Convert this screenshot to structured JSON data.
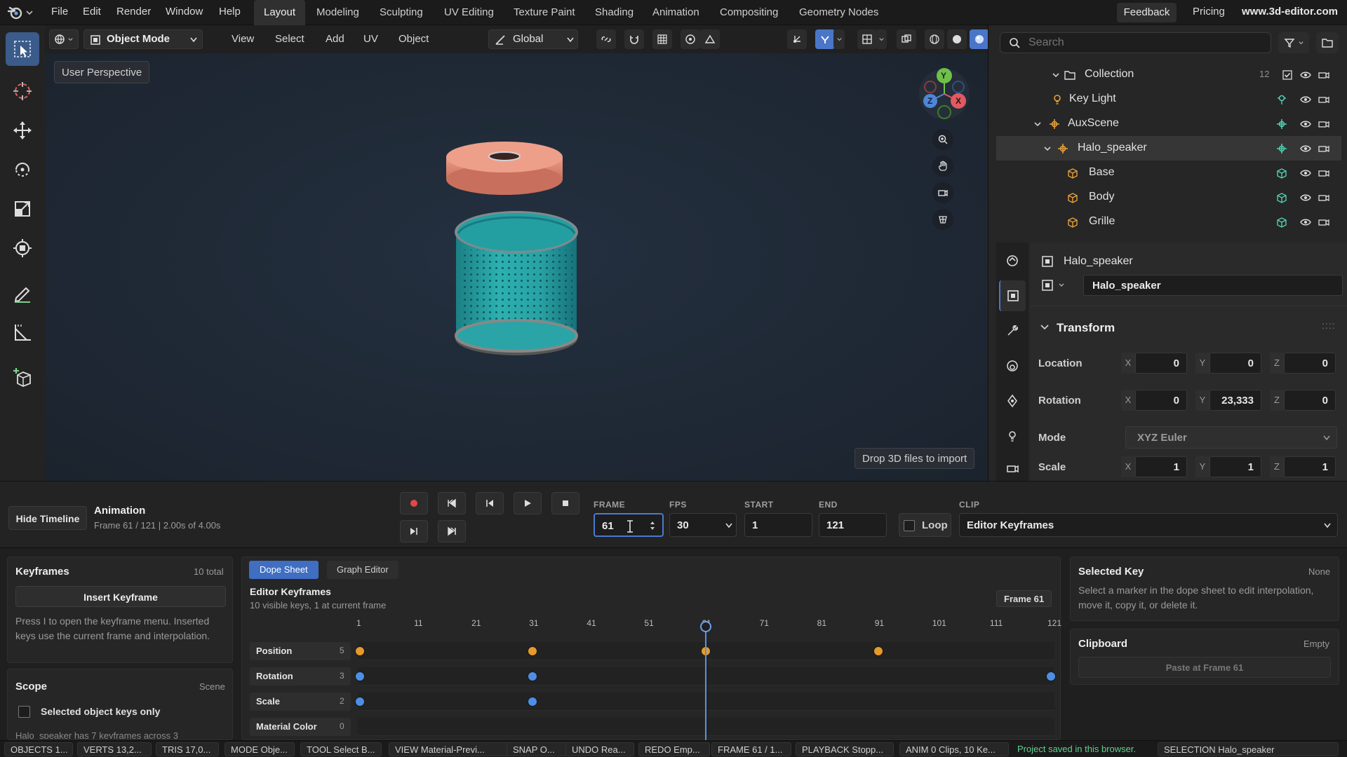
{
  "topbar": {
    "menus": [
      "File",
      "Edit",
      "Render",
      "Window",
      "Help"
    ],
    "workspaces": [
      "Layout",
      "Modeling",
      "Sculpting",
      "UV Editing",
      "Texture Paint",
      "Shading",
      "Animation",
      "Compositing",
      "Geometry Nodes"
    ],
    "active_workspace": "Layout",
    "feedback": "Feedback",
    "pricing": "Pricing",
    "site": "www.3d-editor.com"
  },
  "viewport": {
    "mode": "Object Mode",
    "menus": [
      "View",
      "Select",
      "Add",
      "UV",
      "Object"
    ],
    "orientation": "Global",
    "perspective_label": "User Perspective",
    "drop_hint": "Drop 3D files to import",
    "gizmo": {
      "y": "Y",
      "x": "X",
      "z": "Z"
    },
    "colors": {
      "speaker_body": "#2aa3a3",
      "speaker_top": "#e08c77",
      "background": "#1f2833"
    }
  },
  "outliner": {
    "search_placeholder": "Search",
    "collection": {
      "label": "Collection",
      "count": "12"
    },
    "items": [
      {
        "label": "Key Light"
      },
      {
        "label": "AuxScene"
      },
      {
        "label": "Halo_speaker"
      },
      {
        "label": "Base"
      },
      {
        "label": "Body"
      },
      {
        "label": "Grille"
      }
    ]
  },
  "properties": {
    "object_name": "Halo_speaker",
    "object_field": "Halo_speaker",
    "panel_title": "Transform",
    "location": {
      "label": "Location",
      "x": "0",
      "y": "0",
      "z": "0"
    },
    "rotation": {
      "label": "Rotation",
      "x": "0",
      "y": "23,333",
      "z": "0"
    },
    "mode": {
      "label": "Mode",
      "value": "XYZ Euler"
    },
    "scale": {
      "label": "Scale",
      "x": "1",
      "y": "1",
      "z": "1"
    },
    "axis": {
      "x": "X",
      "y": "Y",
      "z": "Z"
    }
  },
  "timeline": {
    "hide_label": "Hide Timeline",
    "title": "Animation",
    "subtitle": "Frame 61 / 121 | 2.00s of 4.00s",
    "frame": {
      "label": "FRAME",
      "value": "61"
    },
    "fps": {
      "label": "FPS",
      "value": "30"
    },
    "start": {
      "label": "START",
      "value": "1"
    },
    "end": {
      "label": "END",
      "value": "121"
    },
    "loop": "Loop",
    "clip": {
      "label": "CLIP",
      "value": "Editor Keyframes"
    }
  },
  "keyframes_panel": {
    "title": "Keyframes",
    "total": "10 total",
    "insert": "Insert Keyframe",
    "help": "Press I to open the keyframe menu. Inserted keys use the current frame and interpolation.",
    "scope_title": "Scope",
    "scope_value": "Scene",
    "selected_only": "Selected object keys only",
    "summary": "Halo_speaker has 7 keyframes across 3"
  },
  "dopesheet": {
    "tabs": [
      "Dope Sheet",
      "Graph Editor"
    ],
    "title": "Editor Keyframes",
    "subtitle": "10 visible keys, 1 at current frame",
    "frame_badge": "Frame 61",
    "ticks": [
      "1",
      "11",
      "21",
      "31",
      "41",
      "51",
      "61",
      "71",
      "81",
      "91",
      "101",
      "111",
      "121"
    ],
    "current_frame": 61,
    "first_frame": 1,
    "last_frame": 121,
    "rows": [
      {
        "label": "Position",
        "count": "5",
        "keys": [
          1,
          31,
          61,
          91
        ],
        "color": "#e79a2a"
      },
      {
        "label": "Rotation",
        "count": "3",
        "keys": [
          1,
          31,
          121
        ],
        "color": "#4d8fe8"
      },
      {
        "label": "Scale",
        "count": "2",
        "keys": [
          1,
          31
        ],
        "color": "#4d8fe8"
      },
      {
        "label": "Material Color",
        "count": "0",
        "keys": [],
        "color": "#4d8fe8"
      }
    ]
  },
  "selected_key": {
    "title": "Selected Key",
    "value": "None",
    "help": "Select a marker in the dope sheet to edit interpolation, move it, copy it, or delete it."
  },
  "clipboard": {
    "title": "Clipboard",
    "value": "Empty",
    "paste": "Paste at Frame 61"
  },
  "statusbar": [
    "OBJECTS 1...",
    "VERTS 13,2...",
    "TRIS 17,0...",
    "MODE Obje...",
    "TOOL Select B...",
    "VIEW Material-Previ...",
    "SNAP O...",
    "UNDO Rea...",
    "REDO Emp...",
    "FRAME 61 / 1...",
    "PLAYBACK Stopp...",
    "ANIM 0 Clips, 10 Ke...",
    "Project saved in this browser.",
    "SELECTION Halo_speaker"
  ]
}
